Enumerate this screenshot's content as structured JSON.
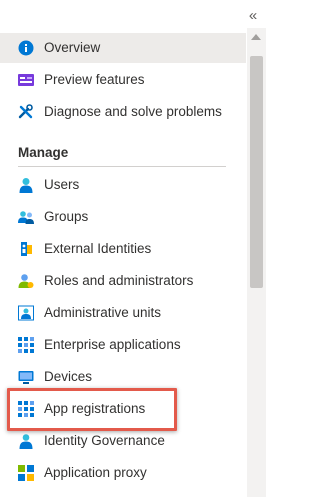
{
  "collapse_glyph": "«",
  "nav": {
    "top_items": [
      {
        "label": "Overview",
        "icon": "info-icon",
        "selected": true
      },
      {
        "label": "Preview features",
        "icon": "preview-features-icon"
      },
      {
        "label": "Diagnose and solve problems",
        "icon": "wrench-icon"
      }
    ],
    "manage_header": "Manage",
    "manage_items": [
      {
        "label": "Users",
        "icon": "user-icon"
      },
      {
        "label": "Groups",
        "icon": "groups-icon"
      },
      {
        "label": "External Identities",
        "icon": "external-identities-icon"
      },
      {
        "label": "Roles and administrators",
        "icon": "roles-icon"
      },
      {
        "label": "Administrative units",
        "icon": "administrative-units-icon"
      },
      {
        "label": "Enterprise applications",
        "icon": "enterprise-apps-icon"
      },
      {
        "label": "Devices",
        "icon": "devices-icon"
      },
      {
        "label": "App registrations",
        "icon": "app-registrations-icon",
        "highlighted": true
      },
      {
        "label": "Identity Governance",
        "icon": "identity-governance-icon"
      },
      {
        "label": "Application proxy",
        "icon": "application-proxy-icon"
      }
    ]
  },
  "colors": {
    "selected_bg": "#edebe9",
    "highlight_border": "#e35a4b",
    "accent_blue": "#0078d4"
  }
}
